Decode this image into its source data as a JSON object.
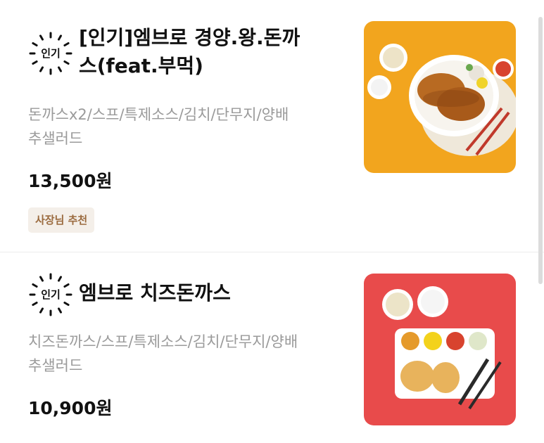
{
  "items": [
    {
      "badge": "인기",
      "title": "[인기]엠브로 경양.왕.돈까스(feat.부먹)",
      "title_line1": "[인기]엠브로 경양.왕.돈까",
      "title_line2": "스(feat.부먹)",
      "description_line1": "돈까스x2/스프/특제소스/김치/단무지/양배",
      "description_line2": "추샐러드",
      "price": "13,500원",
      "tag": "사장님 추천",
      "photo_icon": "pork-cutlet-plate-photo"
    },
    {
      "badge": "인기",
      "title": "엠브로 치즈돈까스",
      "description_line1": "치즈돈까스/스프/특제소스/김치/단무지/양배",
      "description_line2": "추샐러드",
      "price": "10,900원",
      "photo_icon": "cheese-cutlet-tray-photo"
    }
  ],
  "colors": {
    "photo1_bg": "#f2a51e",
    "photo2_bg": "#e84b4b",
    "tag_bg": "#f4efe9",
    "tag_text": "#9b6b3f"
  }
}
